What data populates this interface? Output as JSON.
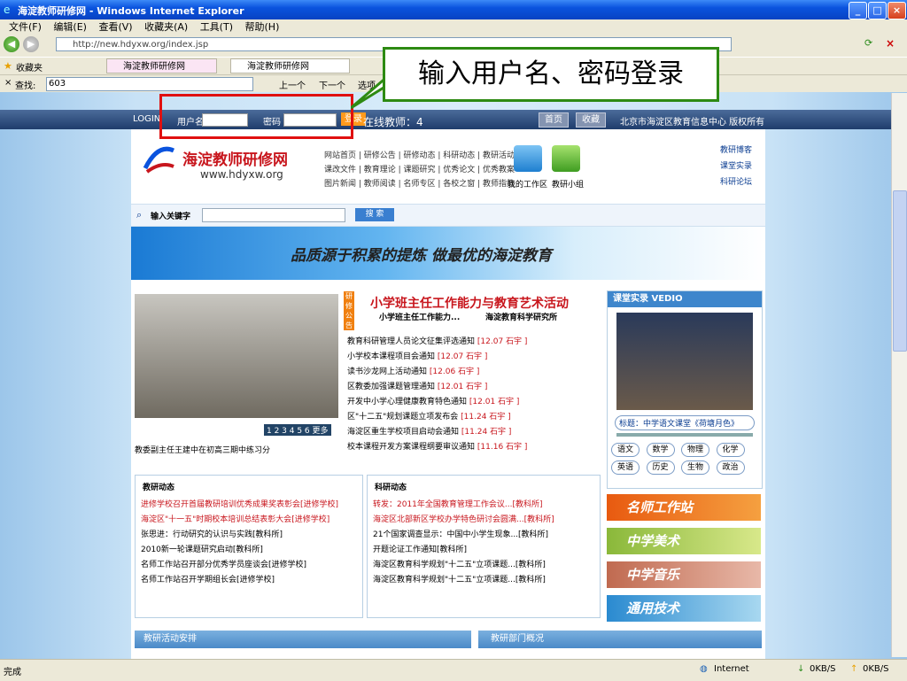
{
  "window": {
    "title": "海淀教师研修网 - Windows Internet Explorer"
  },
  "menu": [
    "文件(F)",
    "编辑(E)",
    "查看(V)",
    "收藏夹(A)",
    "工具(T)",
    "帮助(H)"
  ],
  "address": {
    "url": "http://new.hdyxw.org/index.jsp"
  },
  "favorites": {
    "label": "收藏夹",
    "tab1": "海淀教师研修网",
    "tab2": "海淀教师研修网"
  },
  "findbar": {
    "label": "查找:",
    "value": "603",
    "prev": "上一个",
    "next": "下一个",
    "options": "选项"
  },
  "callout": {
    "text": "输入用户名、密码登录"
  },
  "topnav": {
    "login": "LOGIN",
    "user_label": "用户名",
    "pwd_label": "密码",
    "login_btn": "登录",
    "online": "在线教师：4",
    "home": "首页",
    "fav": "收藏",
    "copyright": "北京市海淀区教育信息中心 版权所有"
  },
  "header": {
    "site_name": "海淀教师研修网",
    "site_url": "www.hdyxw.org",
    "nav_row1": "网站首页 | 研修公告 | 研修动态 | 科研动态 | 教研活动",
    "nav_row2": "课改文件 | 教育理论 | 课题研究 | 优秀论文 | 优秀教案",
    "nav_row3": "图片新闻 | 教师阅读 | 名师专区 | 各校之窗 | 教师指数",
    "my_office": "我的工作区",
    "group": "教研小组",
    "right_links": [
      "教研博客",
      "课堂实录",
      "科研论坛"
    ]
  },
  "search": {
    "label": "输入关键字",
    "button": "搜 索"
  },
  "banner": {
    "slogan": "品质源于积累的提炼   做最优的海淀教育"
  },
  "photo": {
    "caption": "教委副主任王建中在初高三期中练习分",
    "pages": "1 2 3 4 5 6 更多"
  },
  "notice": {
    "badge": "研修公告",
    "headline": "小学班主任工作能力与教育艺术活动",
    "sub1": "小学班主任工作能力...",
    "sub2": "海淀教育科学研究所",
    "items": [
      {
        "title": "教育科研管理人员论文征集评选通知",
        "date": "[12.07 石宇 ]"
      },
      {
        "title": "小学校本课程项目会通知",
        "date": "[12.07 石宇 ]"
      },
      {
        "title": "读书沙龙网上活动通知",
        "date": "[12.06 石宇 ]"
      },
      {
        "title": "区教委加强课题管理通知",
        "date": "[12.01 石宇 ]"
      },
      {
        "title": "开发中小学心理健康教育特色通知",
        "date": "[12.01 石宇 ]"
      },
      {
        "title": "区\"十二五\"规划课题立项发布会",
        "date": "[11.24 石宇 ]"
      },
      {
        "title": "海淀区重生学校项目启动会通知",
        "date": "[11.24 石宇 ]"
      },
      {
        "title": "校本课程开发方案课程纲要审议通知",
        "date": "[11.16 石宇 ]"
      }
    ]
  },
  "video": {
    "title": "课堂实录 VEDIO",
    "caption": "标题：中学语文课堂《荷塘月色》",
    "subjects": [
      "语文",
      "数学",
      "物理",
      "化学",
      "英语",
      "历史",
      "生物",
      "政治"
    ]
  },
  "jiaoyan": {
    "title": "教研动态",
    "items": [
      "进修学校召开首届教研培训优秀成果奖表彰会[进修学校]",
      "海淀区\"十一五\"时期校本培训总结表彰大会[进修学校]",
      "张思进：行动研究的认识与实践[教科所]",
      "2010新一轮课题研究启动[教科所]",
      "名师工作站召开部分优秀学员座谈会[进修学校]",
      "名师工作站召开学期组长会[进修学校]"
    ]
  },
  "keyan": {
    "title": "科研动态",
    "items": [
      "转发：2011年全国教育管理工作会议...[教科所]",
      "海淀区北部新区学校办学特色研讨会圆满...[教科所]",
      "21个国家调查显示：中国中小学生现象...[教科所]",
      "开题论证工作通知[教科所]",
      "海淀区教育科学规划\"十二五\"立项课题...[教科所]",
      "海淀区教育科学规划\"十二五\"立项课题...[教科所]"
    ]
  },
  "side_banners": [
    "名师工作站",
    "中学美术",
    "中学音乐",
    "通用技术"
  ],
  "bottom": {
    "left": "教研活动安排",
    "right": "教研部门概况"
  },
  "status": {
    "text": "完成",
    "zone": "Internet",
    "down": "0KB/S",
    "up": "0KB/S"
  },
  "colors": {
    "accent": "#0a53de",
    "login_red": "#e01010",
    "callout_green": "#2d8a12"
  }
}
